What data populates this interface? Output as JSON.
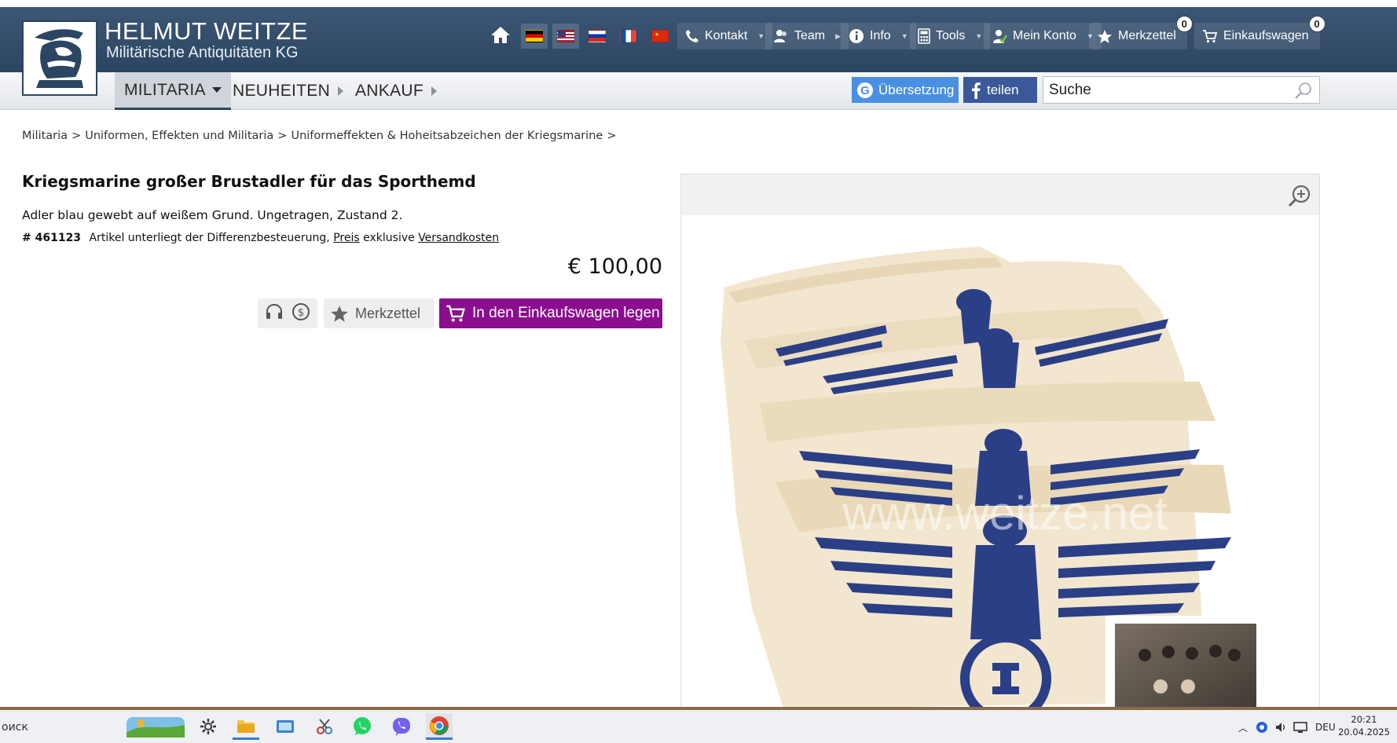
{
  "brand": {
    "title": "HELMUT WEITZE",
    "subtitle": "Militärische Antiquitäten KG"
  },
  "topnav": {
    "items": [
      {
        "label": "Kontakt",
        "icon": "phone-icon"
      },
      {
        "label": "Team",
        "icon": "team-icon"
      },
      {
        "label": "Info",
        "icon": "info-icon"
      },
      {
        "label": "Tools",
        "icon": "calculator-icon"
      },
      {
        "label": "Mein Konto",
        "icon": "account-icon"
      },
      {
        "label": "Merkzettel",
        "icon": "star-icon",
        "badge": "0"
      },
      {
        "label": "Einkaufswagen",
        "icon": "cart-icon",
        "badge": "0"
      }
    ],
    "flags": [
      "de",
      "us",
      "ru",
      "fr",
      "cn"
    ]
  },
  "mainnav": {
    "items": [
      "MILITARIA",
      "NEUHEITEN",
      "ANKAUF"
    ]
  },
  "toolbar": {
    "translate_label": "Übersetzung",
    "share_label": "teilen",
    "search_value": "Suche"
  },
  "breadcrumb": [
    "Militaria",
    "Uniformen, Effekten und Militaria",
    "Uniformeffekten & Hoheitsabzeichen der Kriegsmarine"
  ],
  "product": {
    "title": "Kriegsmarine großer Brustadler für das Sporthemd",
    "description": "Adler blau gewebt auf weißem Grund. Ungetragen, Zustand 2.",
    "number": "# 461123",
    "tax_text": "Artikel unterliegt der Differenzbesteuerung,",
    "price_link": "Preis",
    "exclusive_text": "exklusive",
    "shipping_link": "Versandkosten",
    "price": "€ 100,00",
    "wishlist_label": "Merkzettel",
    "cart_label": "In den Einkaufswagen legen",
    "watermark": "www.weitze.net"
  },
  "taskbar": {
    "search_text": "оиск",
    "lang": "DEU",
    "time": "20:21",
    "date": "20.04.2025"
  },
  "colors": {
    "header": "#34506f",
    "cart_button": "#8a0e8e",
    "translate": "#4a90e2",
    "facebook": "#3b5998",
    "eagle_blue": "#2b3f86"
  }
}
